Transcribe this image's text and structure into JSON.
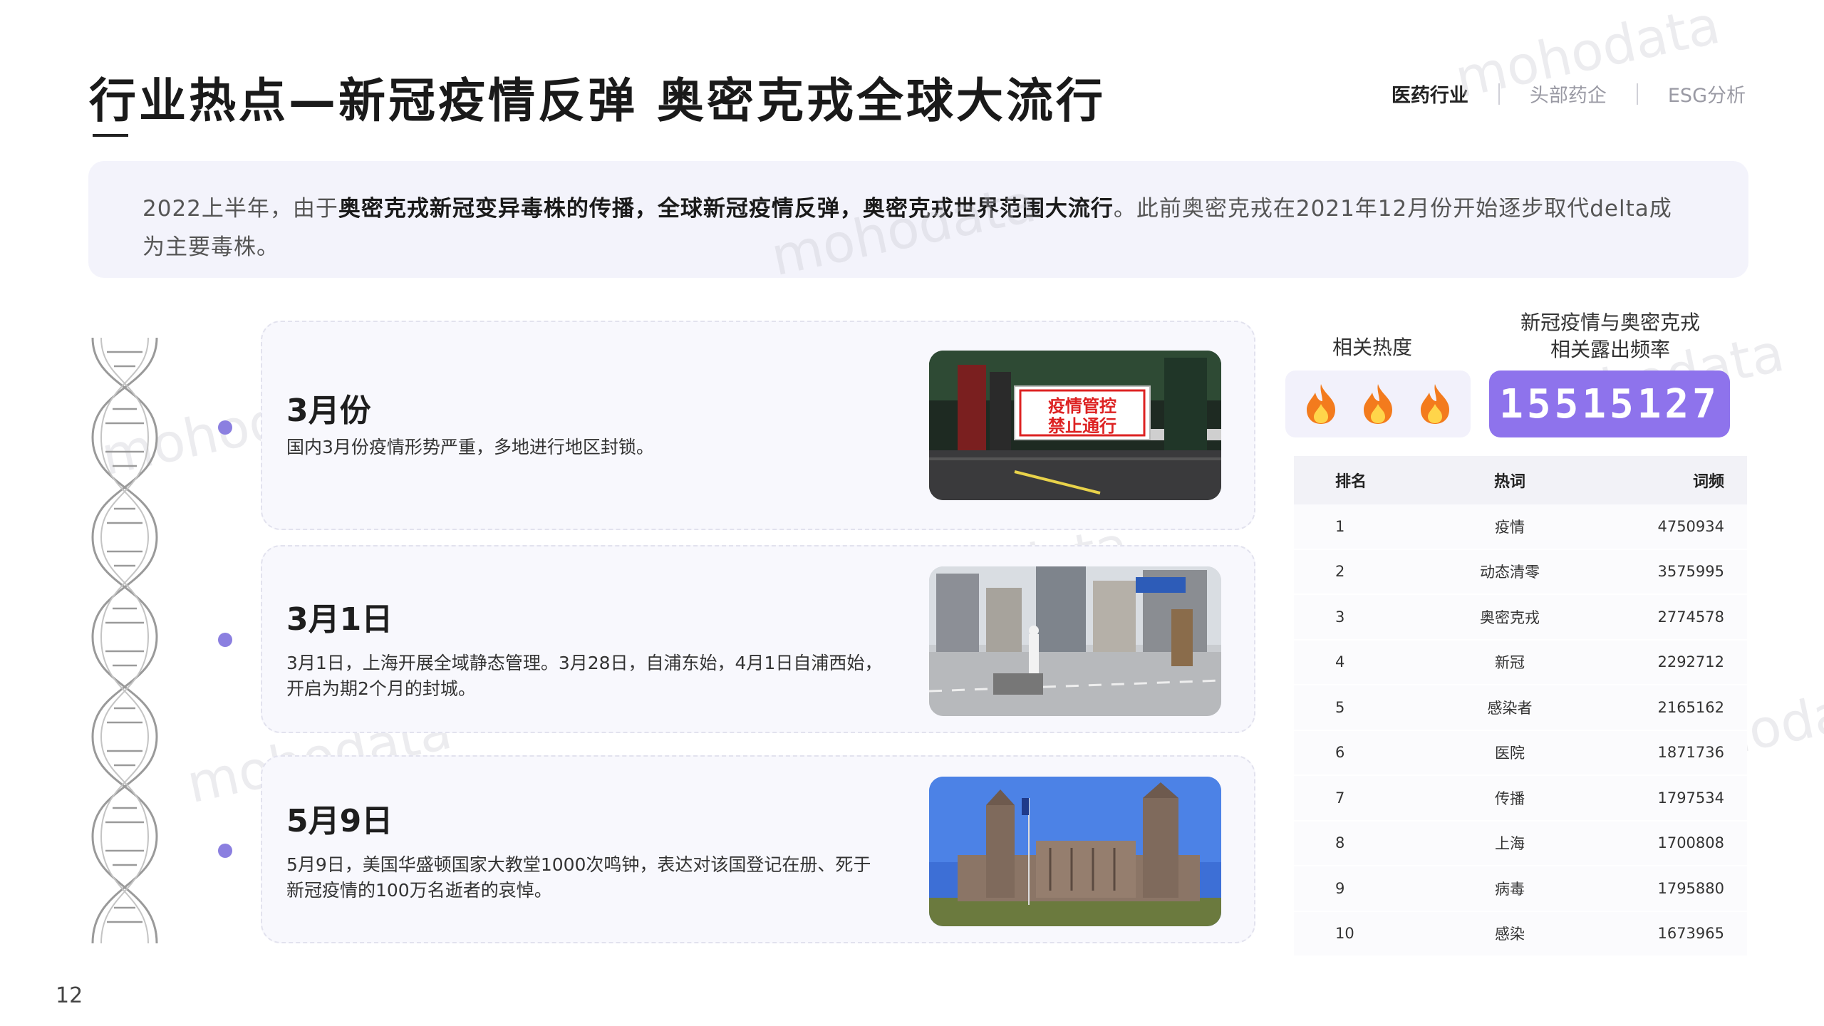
{
  "page": {
    "title": "行业热点—新冠疫情反弹 奥密克戎全球大流行",
    "number": "12"
  },
  "nav": {
    "items": [
      "医药行业",
      "头部药企",
      "ESG分析"
    ],
    "active": 0
  },
  "summary": {
    "p1": "2022上半年，由于",
    "b1": "奥密克戎新冠变异毒株的传播，全球新冠疫情反弹，奥密克戎世界范围大流行",
    "p2": "。此前奥密克戎在2021年12月份开始逐步取代delta成为主要毒株。"
  },
  "watermark": {
    "text": "mohodata"
  },
  "timeline": [
    {
      "date": "3月份",
      "desc": "国内3月份疫情形势严重，多地进行地区封锁。",
      "sign_line1": "疫情管控",
      "sign_line2": "禁止通行"
    },
    {
      "date": "3月1日",
      "desc": "3月1日，上海开展全域静态管理。3月28日，自浦东始，4月1日自浦西始，开启为期2个月的封城。"
    },
    {
      "date": "5月9日",
      "desc": "5月9日，美国华盛顿国家大教堂1000次鸣钟，表达对该国登记在册、死于新冠疫情的100万名逝者的哀悼。"
    }
  ],
  "heat": {
    "label": "相关热度",
    "icons": [
      "fire-icon",
      "fire-icon",
      "fire-icon"
    ]
  },
  "frequency": {
    "label_line1": "新冠疫情与奥密克戎",
    "label_line2": "相关露出频率",
    "value": "15515127"
  },
  "ranking": {
    "headers": [
      "排名",
      "热词",
      "词频"
    ],
    "rows": [
      [
        "1",
        "疫情",
        "4750934"
      ],
      [
        "2",
        "动态清零",
        "3575995"
      ],
      [
        "3",
        "奥密克戎",
        "2774578"
      ],
      [
        "4",
        "新冠",
        "2292712"
      ],
      [
        "5",
        "感染者",
        "2165162"
      ],
      [
        "6",
        "医院",
        "1871736"
      ],
      [
        "7",
        "传播",
        "1797534"
      ],
      [
        "8",
        "上海",
        "1700808"
      ],
      [
        "9",
        "病毒",
        "1795880"
      ],
      [
        "10",
        "感染",
        "1673965"
      ]
    ]
  },
  "colors": {
    "accent": "#8e73ec",
    "dot": "#8b7fe0",
    "fire": "#f37b1d",
    "card_bg": "#f8f8fd",
    "summary_bg": "#f3f3fb"
  }
}
